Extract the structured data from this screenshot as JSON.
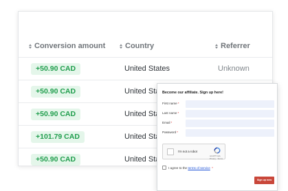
{
  "table": {
    "columns": [
      {
        "label": "Conversion amount"
      },
      {
        "label": "Country"
      },
      {
        "label": "Referrer"
      }
    ],
    "rows": [
      {
        "amount": "+50.90 CAD",
        "country": "United States",
        "referrer": "Unknown"
      },
      {
        "amount": "+50.90 CAD",
        "country": "United States",
        "referrer": ""
      },
      {
        "amount": "+50.90 CAD",
        "country": "United States",
        "referrer": ""
      },
      {
        "amount": "+101.79 CAD",
        "country": "United States",
        "referrer": ""
      },
      {
        "amount": "+50.90 CAD",
        "country": "United States",
        "referrer": ""
      }
    ],
    "colors": {
      "amount_text": "#1f9d4c",
      "amount_bg": "#e4f6ea"
    }
  },
  "signup_form": {
    "title": "Become our affiliate. Sign up here!",
    "fields": [
      {
        "label": "First name",
        "required_mark": "*",
        "value": ""
      },
      {
        "label": "Last name",
        "required_mark": "*",
        "value": ""
      },
      {
        "label": "Email",
        "required_mark": "*",
        "value": ""
      },
      {
        "label": "Password",
        "required_mark": "*",
        "value": ""
      }
    ],
    "captcha": {
      "label": "I'm not a robot",
      "brand": "reCAPTCHA",
      "links": "Privacy - Terms",
      "icon": "recaptcha-icon"
    },
    "terms": {
      "prefix": "I agree to the",
      "link": "terms of service",
      "required_mark": "*"
    },
    "submit_label": "Sign up now",
    "colors": {
      "submit_bg": "#c9473a",
      "input_bg": "#edf1fb",
      "link": "#1a4fd6"
    }
  }
}
